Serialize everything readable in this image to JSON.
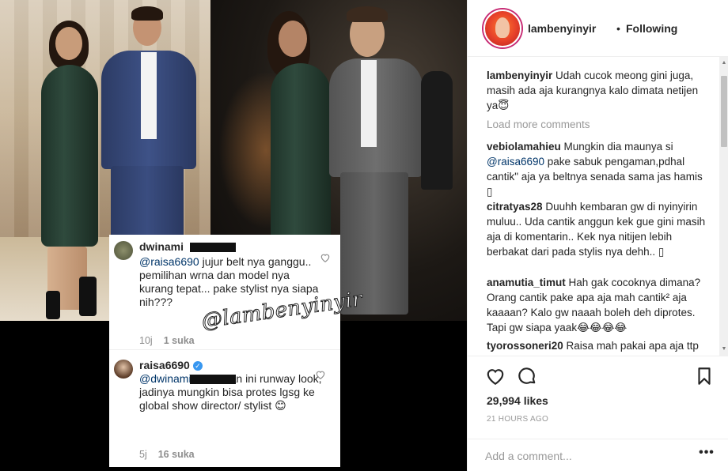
{
  "post": {
    "author": "lambenyinyir",
    "separator": "•",
    "follow_status": "Following",
    "likes": "29,994 likes",
    "time_ago": "21 HOURS AGO",
    "comment_placeholder": "Add a comment...",
    "more_label": "•••"
  },
  "image": {
    "watermark": "@lambenyinyir",
    "overlay_comments": [
      {
        "user": "dwinami",
        "mention": "@raisa6690",
        "text": " jujur belt nya ganggu.. pemilihan wrna dan model nya kurang tepat... pake stylist nya siapa nih???",
        "age": "10j",
        "likes": "1 suka"
      },
      {
        "user": "raisa6690",
        "mention": "@dwinami",
        "text": " kebetulan ini runway look, jadinya mungkin bisa protes lgsg ke global show director/ stylist 😊",
        "age": "5j",
        "likes": "16 suka"
      }
    ]
  },
  "comments": {
    "caption": {
      "user": "lambenyinyir",
      "text": " Udah cucok meong gini juga, masih ada aja kurangnya kalo dimata netijen ya😇"
    },
    "load_more": "Load more comments",
    "items": [
      {
        "user": "vebiolamahieu",
        "text": " Mungkin dia maunya si ",
        "mention": "@raisa6690",
        "text2": " pake sabuk pengaman,pdhal cantik\" aja ya beltnya senada sama jas hamis ▯"
      },
      {
        "user": "citratyas28",
        "text": " Duuhh kembaran gw di nyinyirin muluu.. Uda cantik anggun kek gue gini masih aja di komentarin.. Kek nya nitijen lebih berbakat dari pada stylis nya dehh.. ▯"
      },
      {
        "user": "anamutia_timut",
        "text": " Hah gak cocoknya dimana? Orang cantik pake apa aja mah cantik² aja kaaaan? Kalo gw naaah boleh deh diprotes. Tapi gw siapa yaak😂😂😂😂"
      },
      {
        "user": "tyorossoneri20",
        "text": " Raisa mah pakai apa aja ttp cantik apa lagi kla gak pakai apa apa! 😂😂"
      }
    ]
  },
  "colors": {
    "link": "#003569",
    "muted": "#999999",
    "verified": "#3897f0",
    "border": "#efefef"
  },
  "icons": [
    "heart-icon",
    "comment-icon",
    "bookmark-icon",
    "more-icon",
    "verified-icon"
  ]
}
